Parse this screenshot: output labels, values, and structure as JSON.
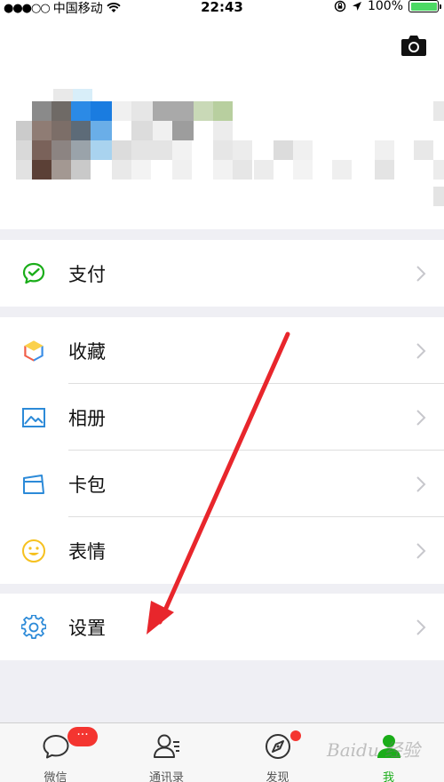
{
  "status_bar": {
    "signal": "●●●○○",
    "carrier": "中国移动",
    "time": "22:43",
    "battery": "100%"
  },
  "profile": {
    "camera_icon": "camera-icon"
  },
  "menu": {
    "pay": {
      "label": "支付",
      "icon": "wechat-pay-icon",
      "color": "#1aad19"
    },
    "favorites": {
      "label": "收藏",
      "icon": "cube-icon"
    },
    "album": {
      "label": "相册",
      "icon": "photo-icon",
      "color": "#2c8ad8"
    },
    "cards": {
      "label": "卡包",
      "icon": "card-wallet-icon",
      "color": "#2c8ad8"
    },
    "stickers": {
      "label": "表情",
      "icon": "smiley-icon",
      "color": "#f6c120"
    },
    "settings": {
      "label": "设置",
      "icon": "gear-icon",
      "color": "#2c8ad8"
    }
  },
  "tabbar": {
    "chats": {
      "label": "微信",
      "badge": "···"
    },
    "contacts": {
      "label": "通讯录"
    },
    "discover": {
      "label": "发现"
    },
    "me": {
      "label": "我"
    }
  },
  "colors": {
    "accent_green": "#1aad19",
    "badge_red": "#f43530",
    "annotation_red": "#e8262c"
  },
  "watermark": "Baidu 经验"
}
